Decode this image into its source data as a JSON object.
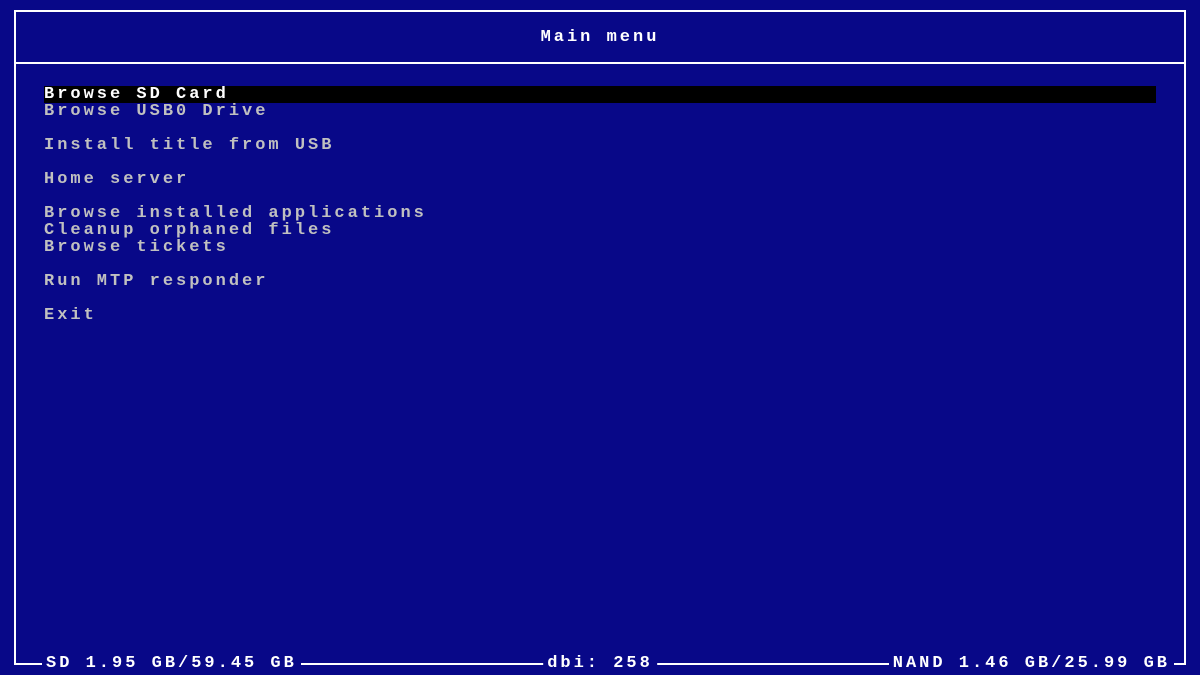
{
  "header": {
    "title": "Main menu"
  },
  "menu": {
    "groups": [
      [
        {
          "label": "Browse SD Card",
          "selected": true
        },
        {
          "label": "Browse USB0 Drive",
          "selected": false
        }
      ],
      [
        {
          "label": "Install title from USB",
          "selected": false
        }
      ],
      [
        {
          "label": "Home server",
          "selected": false
        }
      ],
      [
        {
          "label": "Browse installed applications",
          "selected": false
        },
        {
          "label": "Cleanup orphaned files",
          "selected": false
        },
        {
          "label": "Browse tickets",
          "selected": false
        }
      ],
      [
        {
          "label": "Run MTP responder",
          "selected": false
        }
      ],
      [
        {
          "label": "Exit",
          "selected": false
        }
      ]
    ]
  },
  "status": {
    "left": "SD 1.95 GB/59.45 GB",
    "center": "dbi: 258",
    "right": "NAND 1.46 GB/25.99 GB"
  }
}
